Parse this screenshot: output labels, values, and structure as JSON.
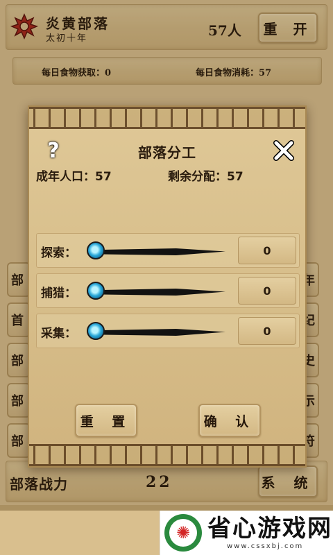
{
  "header": {
    "tribe_name": "炎黄部落",
    "era": "太初十年",
    "population": "57人",
    "restart_label": "重 开"
  },
  "food": {
    "gain": "每日食物获取：0",
    "cost": "每日食物消耗：57"
  },
  "side_buttons": {
    "left": [
      "部",
      "首",
      "部",
      "部",
      "部"
    ],
    "right": [
      "年",
      "纪",
      "史",
      "示",
      "符"
    ]
  },
  "bottom": {
    "power_label": "部落战力",
    "power_value": "22",
    "system_label": "系 统"
  },
  "dialog": {
    "help_icon": "?",
    "title": "部落分工",
    "adult_population": "成年人口：57",
    "remaining": "剩余分配：57",
    "jobs": [
      {
        "label": "探索：",
        "value": "0",
        "fraction": 0
      },
      {
        "label": "捕猎：",
        "value": "0",
        "fraction": 0
      },
      {
        "label": "采集：",
        "value": "0",
        "fraction": 0
      }
    ],
    "reset_label": "重 置",
    "confirm_label": "确 认"
  },
  "ad": {
    "title": "省心游戏网",
    "url": "www.cssxbj.com"
  },
  "colors": {
    "parchment": "#d9bf8e",
    "border": "#b39460",
    "knob": "#2aa8d8",
    "ad_green": "#2a8a3e"
  }
}
